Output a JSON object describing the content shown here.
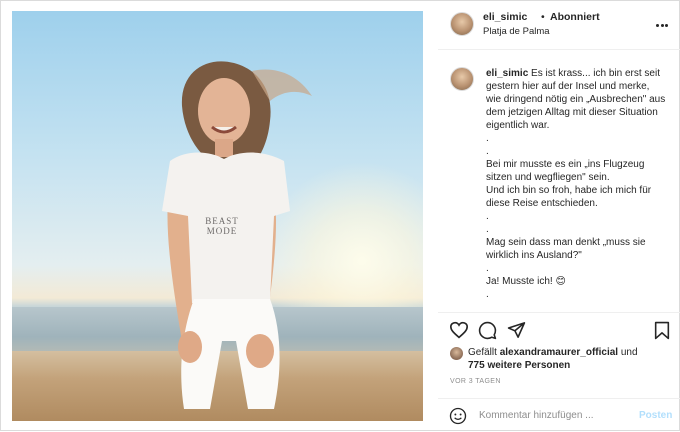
{
  "post": {
    "username": "eli_simic",
    "separator": "•",
    "follow_status": "Abonniert",
    "location": "Platja de Palma"
  },
  "caption": {
    "username": "eli_simic",
    "lines": [
      "Es ist krass... ich bin erst seit gestern hier auf der Insel und merke, wie dringend nötig ein „Ausbrechen\" aus dem jetzigen Alltag mit dieser Situation eigentlich war.",
      ".",
      ".",
      "Bei mir musste es ein „ins Flugzeug sitzen und wegfliegen\" sein.",
      "Und ich bin so froh, habe ich mich für diese Reise entschieden.",
      ".",
      ".",
      "Mag sein dass man denkt „muss sie wirklich ins Ausland?\"",
      ".",
      "Ja! Musste ich! 😊",
      "."
    ]
  },
  "shirt_print": "BEAST MODE",
  "likes": {
    "prefix": "Gefällt",
    "user": "alexandramaurer_official",
    "connector": "und",
    "others": "775 weitere Personen"
  },
  "timestamp": "VOR 3 TAGEN",
  "comment": {
    "placeholder": "Kommentar hinzufügen ...",
    "post_label": "Posten"
  },
  "icons": {
    "more": "more-options-icon",
    "like": "heart-icon",
    "comment": "comment-icon",
    "share": "share-icon",
    "save": "bookmark-icon",
    "emoji": "emoji-icon"
  },
  "colors": {
    "text": "#262626",
    "muted": "#8e8e8e",
    "post_button": "#b2dffc",
    "border": "#dbdbdb"
  }
}
